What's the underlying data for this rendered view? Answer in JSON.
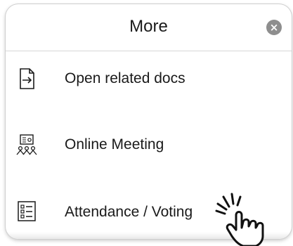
{
  "header": {
    "title": "More",
    "close_icon": "close-icon"
  },
  "menu": {
    "items": [
      {
        "label": "Open related docs",
        "icon": "document-arrow-icon"
      },
      {
        "label": "Online Meeting",
        "icon": "online-meeting-icon"
      },
      {
        "label": "Attendance / Voting",
        "icon": "attendance-list-icon"
      }
    ]
  },
  "overlay": {
    "pointer_icon": "tap-hand-icon"
  },
  "colors": {
    "text": "#1a1a1a",
    "close_button": "#8e8e8e",
    "divider": "#d6d6d6"
  }
}
